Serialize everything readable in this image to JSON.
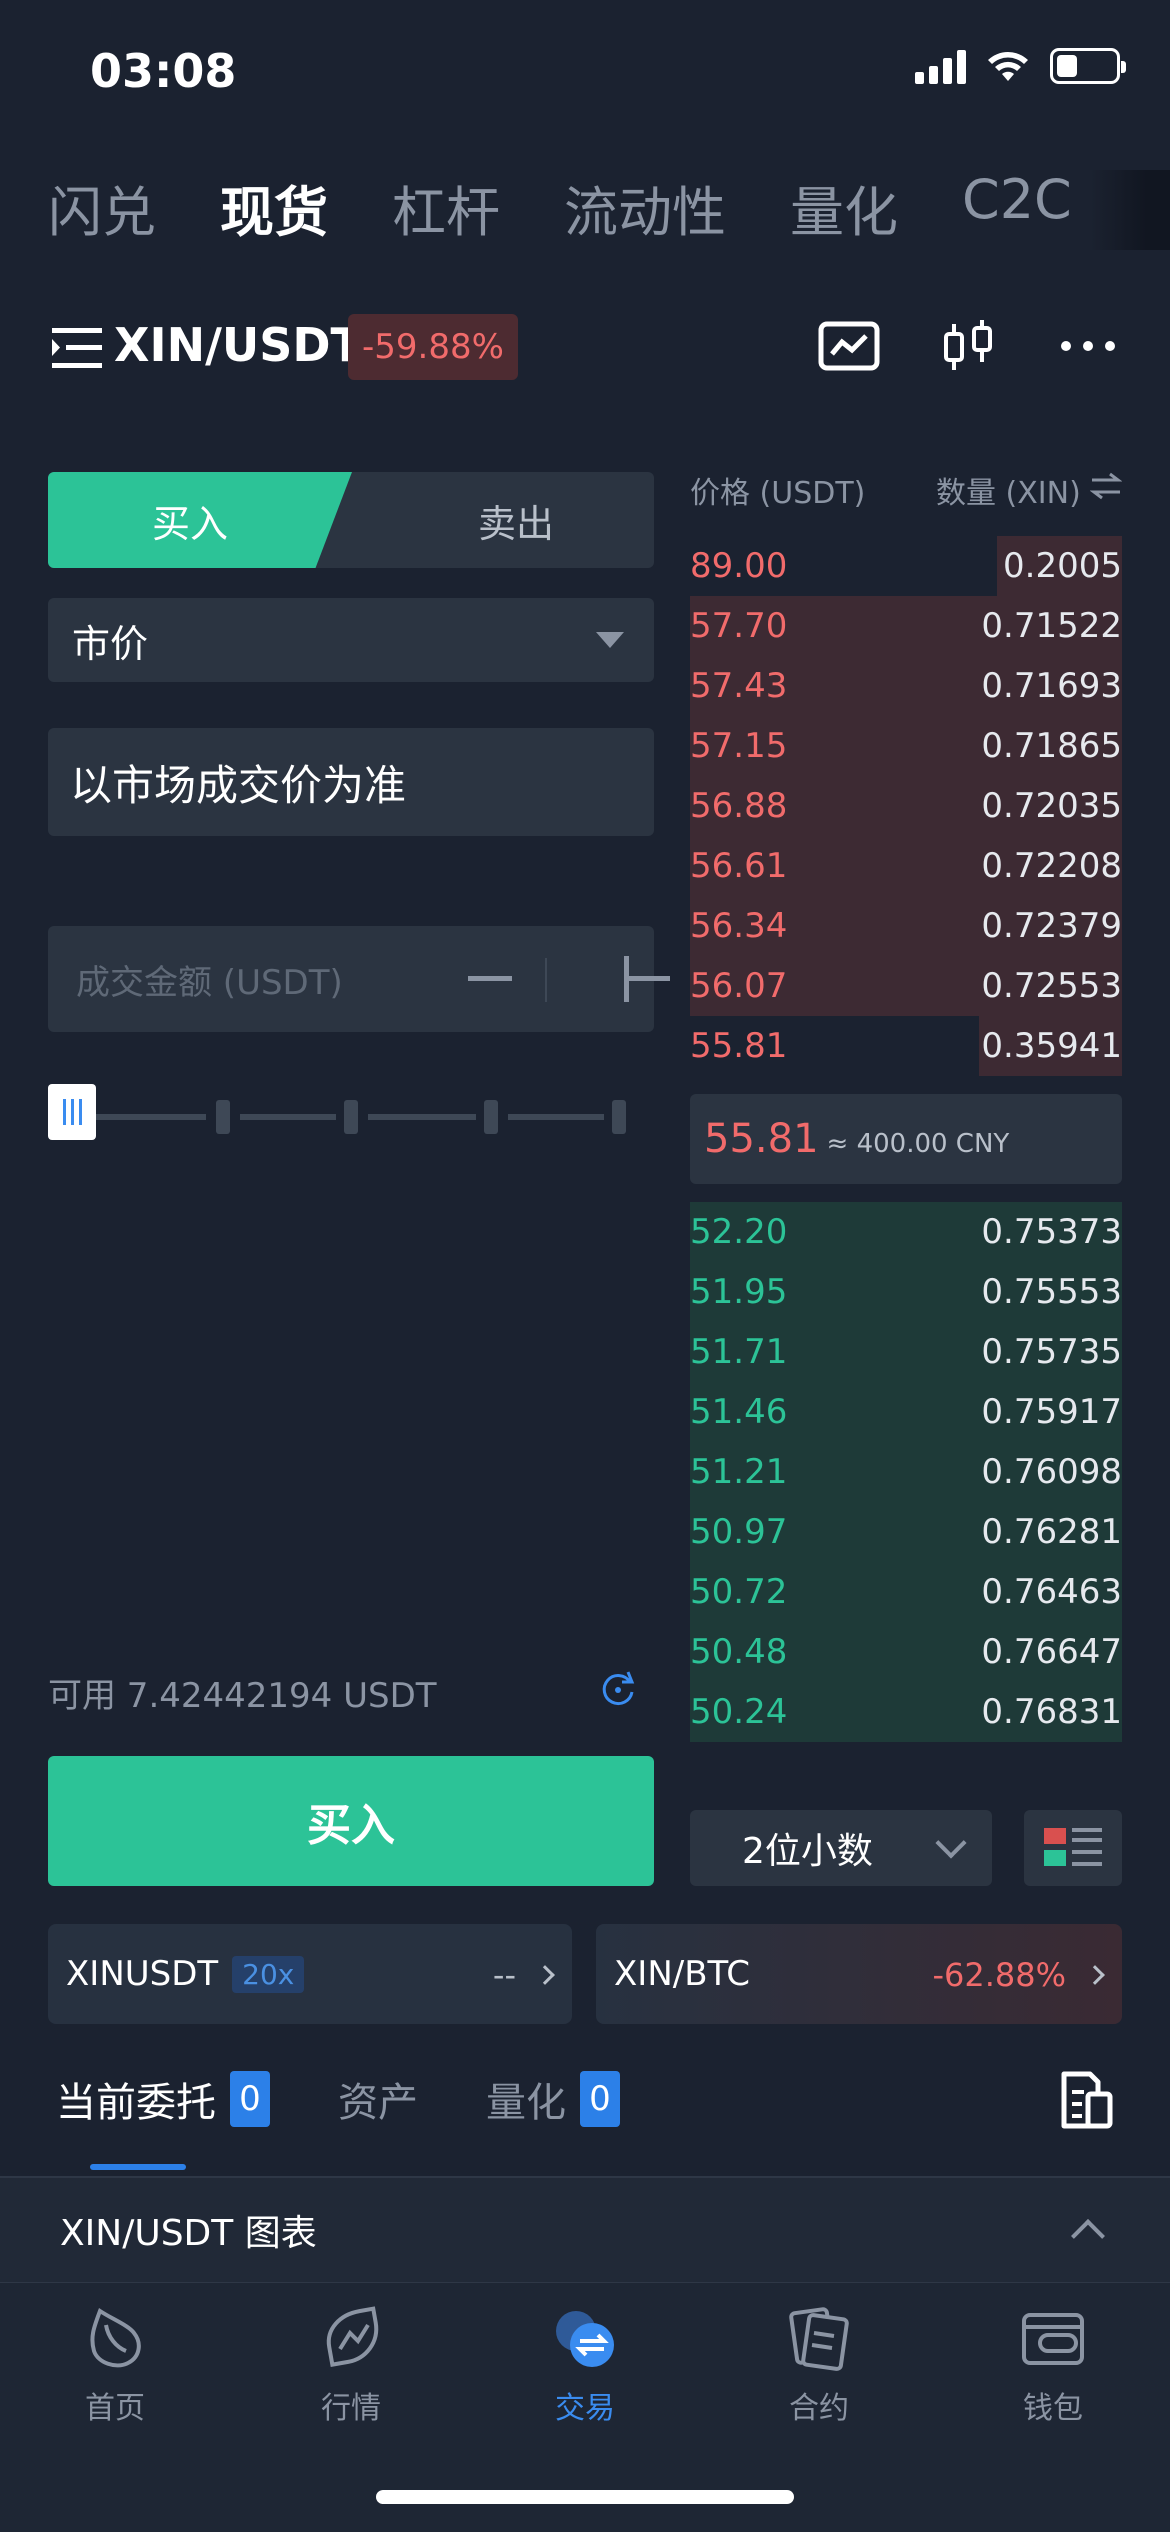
{
  "status": {
    "time": "03:08"
  },
  "top_tabs": [
    {
      "label": "闪兑",
      "active": false
    },
    {
      "label": "现货",
      "active": true
    },
    {
      "label": "杠杆",
      "active": false
    },
    {
      "label": "流动性",
      "active": false
    },
    {
      "label": "量化",
      "active": false
    },
    {
      "label": "C2C",
      "active": false
    }
  ],
  "pair": {
    "name": "XIN/USDT",
    "change": "-59.88%"
  },
  "trade": {
    "buy_label": "买入",
    "sell_label": "卖出",
    "order_type": "市价",
    "market_price_text": "以市场成交价为准",
    "amount_placeholder": "成交金额 (USDT)",
    "available": "可用 7.42442194 USDT",
    "submit_label": "买入",
    "slider_percent": 0
  },
  "orderbook": {
    "price_header": "价格 (USDT)",
    "qty_header": "数量 (XIN)",
    "asks": [
      {
        "price": "89.00",
        "qty": "0.2005",
        "depth": 0.29
      },
      {
        "price": "57.70",
        "qty": "0.71522",
        "depth": 1.0
      },
      {
        "price": "57.43",
        "qty": "0.71693",
        "depth": 1.0
      },
      {
        "price": "57.15",
        "qty": "0.71865",
        "depth": 1.0
      },
      {
        "price": "56.88",
        "qty": "0.72035",
        "depth": 1.0
      },
      {
        "price": "56.61",
        "qty": "0.72208",
        "depth": 1.0
      },
      {
        "price": "56.34",
        "qty": "0.72379",
        "depth": 1.0
      },
      {
        "price": "56.07",
        "qty": "0.72553",
        "depth": 1.0
      },
      {
        "price": "55.81",
        "qty": "0.35941",
        "depth": 0.33
      }
    ],
    "mid_price": "55.81",
    "mid_cny": "≈ 400.00 CNY",
    "bids": [
      {
        "price": "52.20",
        "qty": "0.75373",
        "depth": 1.0
      },
      {
        "price": "51.95",
        "qty": "0.75553",
        "depth": 1.0
      },
      {
        "price": "51.71",
        "qty": "0.75735",
        "depth": 1.0
      },
      {
        "price": "51.46",
        "qty": "0.75917",
        "depth": 1.0
      },
      {
        "price": "51.21",
        "qty": "0.76098",
        "depth": 1.0
      },
      {
        "price": "50.97",
        "qty": "0.76281",
        "depth": 1.0
      },
      {
        "price": "50.72",
        "qty": "0.76463",
        "depth": 1.0
      },
      {
        "price": "50.48",
        "qty": "0.76647",
        "depth": 1.0
      },
      {
        "price": "50.24",
        "qty": "0.76831",
        "depth": 1.0
      }
    ],
    "decimals": "2位小数"
  },
  "related": [
    {
      "name": "XINUSDT",
      "badge": "20x",
      "value": "--"
    },
    {
      "name": "XIN/BTC",
      "value": "-62.88%"
    }
  ],
  "bottom_tabs": [
    {
      "label": "当前委托",
      "count": "0",
      "active": true
    },
    {
      "label": "资产",
      "active": false
    },
    {
      "label": "量化",
      "count": "0",
      "active": false
    }
  ],
  "chart_bar": {
    "label": "XIN/USDT 图表"
  },
  "nav": [
    {
      "label": "首页",
      "icon": "home-icon",
      "active": false
    },
    {
      "label": "行情",
      "icon": "market-icon",
      "active": false
    },
    {
      "label": "交易",
      "icon": "trade-icon",
      "active": true
    },
    {
      "label": "合约",
      "icon": "contract-icon",
      "active": false
    },
    {
      "label": "钱包",
      "icon": "wallet-icon",
      "active": false
    }
  ],
  "colors": {
    "green": "#2cc397",
    "red": "#f16b6b",
    "blue": "#2c80e8",
    "bg": "#1b2230"
  }
}
